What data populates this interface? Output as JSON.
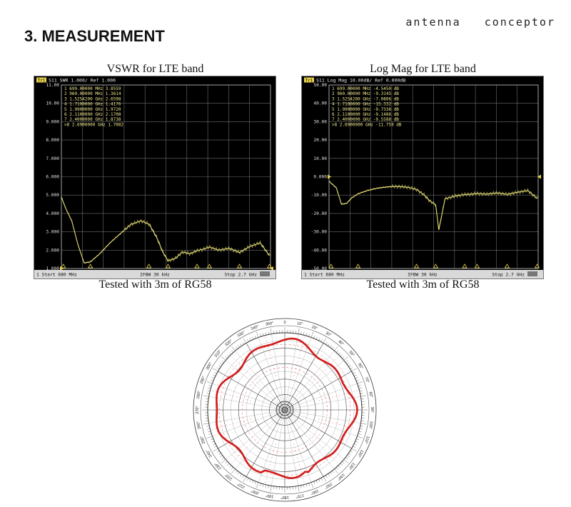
{
  "brand": "antenna   conceptor",
  "heading": "3. MEASUREMENT",
  "charts": [
    {
      "title": "VSWR for LTE band",
      "caption": "Tested with 3m of RG58",
      "header": "S11  SWR 1.000/ Ref 1.000",
      "channel": "Tr1",
      "footer_left": "1  Start 680 MHz",
      "footer_mid": "IFBW 30 kHz",
      "footer_right": "Stop 2.7 GHz",
      "y_ticks": [
        "11.00",
        "10.00",
        "9.000",
        "8.000",
        "7.000",
        "6.000",
        "5.000",
        "4.000",
        "3.000",
        "2.000",
        "1.000"
      ],
      "markers": [
        "1   699.00000  MHz   3.8559",
        "2   960.00000  MHz   1.3614",
        "3   1.5254200  GHz   2.6598",
        "4   1.7100000  GHz   1.4176",
        "5   1.9900000  GHz   1.9720",
        "6   2.1100000  GHz   2.1708",
        "7   2.4000000  GHz   1.8738",
        ">8  2.6900000  GHz   1.7082"
      ]
    },
    {
      "title": "Log Mag for LTE band",
      "caption": "Tested with 3m of RG58",
      "header": "S11  Log Mag 10.00dB/ Ref 0.000dB",
      "channel": "Tr1",
      "footer_left": "1  Start 680 MHz",
      "footer_mid": "IFBW 30 kHz",
      "footer_right": "Stop 2.7 GHz",
      "y_ticks": [
        "50.00",
        "40.00",
        "30.00",
        "20.00",
        "10.00",
        "0.000",
        "-10.00",
        "-20.00",
        "-30.00",
        "-40.00",
        "-50.00"
      ],
      "markers": [
        "1   699.00000  MHz   -4.5450  dB",
        "2   960.00000  MHz   -9.3145  dB",
        "3   1.5254200  GHz   -7.0806  dB",
        "4   1.7100000  GHz   -15.332  dB",
        "5   1.9900000  GHz   -9.7338  dB",
        "6   2.1100000  GHz   -9.1486  dB",
        "7   2.4000000  GHz   -9.5588  dB",
        ">8  2.6900000  GHz   -11.759  dB"
      ]
    }
  ],
  "chart_data": [
    {
      "type": "line",
      "title": "VSWR for LTE band",
      "xlabel": "",
      "ylabel": "",
      "x_unit": "GHz",
      "xlim": [
        0.68,
        2.7
      ],
      "ylim": [
        1,
        11
      ],
      "x": [
        0.68,
        0.72,
        0.78,
        0.84,
        0.9,
        0.96,
        1.05,
        1.15,
        1.25,
        1.35,
        1.45,
        1.53,
        1.6,
        1.66,
        1.71,
        1.78,
        1.85,
        1.92,
        1.99,
        2.05,
        2.11,
        2.2,
        2.3,
        2.4,
        2.5,
        2.6,
        2.69
      ],
      "y": [
        4.9,
        4.3,
        3.6,
        2.3,
        1.3,
        1.36,
        1.8,
        2.4,
        2.9,
        3.4,
        3.6,
        3.4,
        2.7,
        1.9,
        1.42,
        1.55,
        1.9,
        1.8,
        1.97,
        2.05,
        2.17,
        2.0,
        2.1,
        1.87,
        2.2,
        2.4,
        1.71
      ]
    },
    {
      "type": "line",
      "title": "Log Mag for LTE band",
      "xlabel": "",
      "ylabel": "",
      "x_unit": "GHz",
      "xlim": [
        0.68,
        2.7
      ],
      "ylim": [
        -50,
        50
      ],
      "x": [
        0.68,
        0.7,
        0.75,
        0.8,
        0.85,
        0.9,
        0.96,
        1.05,
        1.15,
        1.25,
        1.35,
        1.45,
        1.53,
        1.6,
        1.65,
        1.71,
        1.74,
        1.8,
        1.9,
        1.99,
        2.05,
        2.11,
        2.2,
        2.3,
        2.4,
        2.5,
        2.6,
        2.69
      ],
      "y": [
        -2.5,
        -3.5,
        -6,
        -15,
        -14.5,
        -11.5,
        -9.3,
        -7.5,
        -6.2,
        -5.5,
        -5.3,
        -5.8,
        -7.1,
        -10,
        -13,
        -15.3,
        -29,
        -12,
        -10.5,
        -9.7,
        -9.5,
        -9.1,
        -9.5,
        -8.8,
        -9.6,
        -8.5,
        -7.5,
        -11.8
      ]
    }
  ],
  "polar": {
    "angle_labels": [
      "0",
      "10°",
      "20°",
      "30°",
      "40°",
      "50°",
      "60°",
      "70°",
      "80°",
      "90°",
      "100°",
      "110°",
      "120°",
      "130°",
      "140°",
      "150°",
      "160°",
      "170°",
      "180°",
      "190°",
      "200°",
      "210°",
      "220°",
      "230°",
      "240°",
      "250°",
      "260°",
      "270°",
      "280°",
      "290°",
      "300°",
      "310°",
      "320°",
      "330°",
      "340°",
      "350°"
    ],
    "pattern_color": "#d11a1a"
  }
}
